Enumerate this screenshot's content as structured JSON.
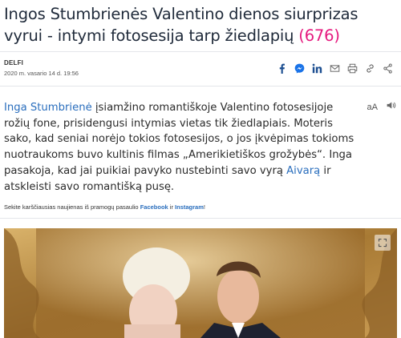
{
  "article": {
    "title_main": "Ingos Stumbrienės Valentino dienos siurprizas vyrui - intymi fotosesija tarp žiedlapių",
    "comment_count": "(676)",
    "source": "DELFI",
    "date": "2020 m. vasario 14 d. 19:56",
    "lead": {
      "person1": "Inga Stumbrienė",
      "part1": " įsiamžino romantiškoje Valentino fotosesijoje rožių fone, prisidengusi intymias vietas tik žiedlapiais. Moteris sako, kad seniai norėjo tokios fotosesijos, o jos įkvėpimas tokioms nuotraukoms buvo kultinis filmas „Amerikietiškos grožybės“. Inga pasakoja, kad jai puikiai pavyko nustebinti savo vyrą ",
      "person2": "Aivarą",
      "part2": " ir atskleisti savo romantišką pusę."
    },
    "follow": {
      "prefix": "Sekite karščiausias naujienas iš pramogų pasaulio ",
      "facebook": "Facebook",
      "middle": " ir ",
      "instagram": "Instagram",
      "suffix": "!"
    },
    "font_toggle": "aA"
  },
  "share_icons": [
    "facebook-icon",
    "messenger-icon",
    "linkedin-icon",
    "email-icon",
    "print-icon",
    "link-icon",
    "share-icon"
  ],
  "colors": {
    "accent_pink": "#e5197e",
    "link_blue": "#2a6ebd",
    "icon_blue": "#1d4f91"
  }
}
